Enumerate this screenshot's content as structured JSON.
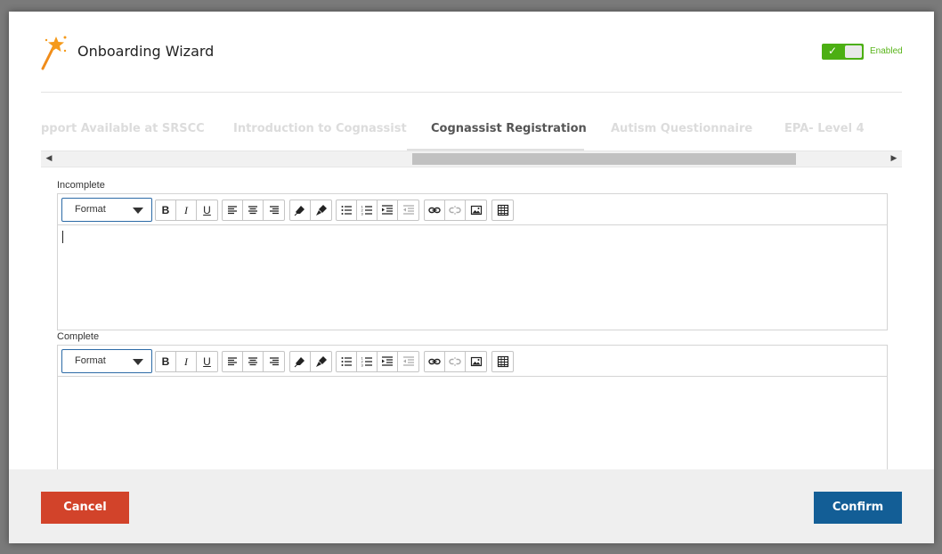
{
  "window": {
    "title": "Onboarding Wizard"
  },
  "header": {
    "toggle": {
      "state": "on",
      "label": "Enabled"
    }
  },
  "tabs": [
    {
      "label": "Support Available at SRSCC",
      "visible_text": "pport Available at SRSCC",
      "active": false
    },
    {
      "label": "Introduction to Cognassist",
      "active": false
    },
    {
      "label": "Cognassist Registration",
      "active": true
    },
    {
      "label": "Autism Questionnaire",
      "active": false
    },
    {
      "label": "EPA- Level 4",
      "active": false
    }
  ],
  "editors": [
    {
      "label": "Incomplete",
      "format_label": "Format",
      "value": ""
    },
    {
      "label": "Complete",
      "format_label": "Format",
      "value": ""
    }
  ],
  "toolbar": {
    "bold": "B",
    "italic": "I",
    "underline": "U"
  },
  "footer": {
    "cancel_label": "Cancel",
    "confirm_label": "Confirm"
  },
  "colors": {
    "cancel": "#d2432a",
    "confirm": "#135e96",
    "toggle_on": "#4caf13",
    "accent_blue": "#2c6aa6"
  }
}
